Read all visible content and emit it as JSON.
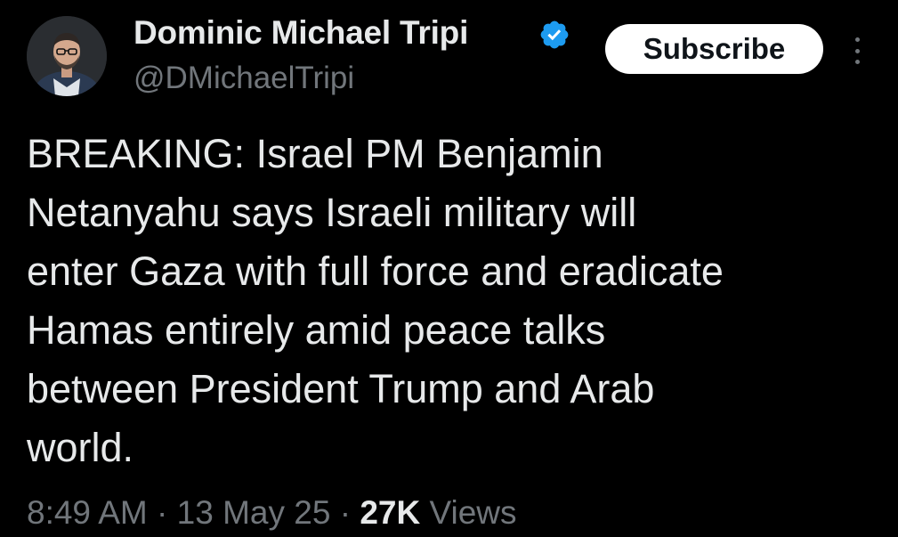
{
  "author": {
    "name": "Dominic Michael Tripi",
    "handle": "@DMichaelTripi",
    "verified": true,
    "verified_icon": "verified-badge-icon",
    "verified_color": "#1d9bf0"
  },
  "actions": {
    "subscribe_label": "Subscribe",
    "more_icon": "more-vertical-icon"
  },
  "tweet": {
    "lines": [
      "BREAKING: Israel PM Benjamin",
      "Netanyahu says Israeli military will",
      "enter Gaza with full force and eradicate",
      "Hamas entirely amid peace talks",
      "between President Trump and Arab",
      "world."
    ]
  },
  "meta": {
    "time": "8:49 AM",
    "separator": "·",
    "date": "13 May 25",
    "views_count": "27K",
    "views_label": "Views"
  }
}
